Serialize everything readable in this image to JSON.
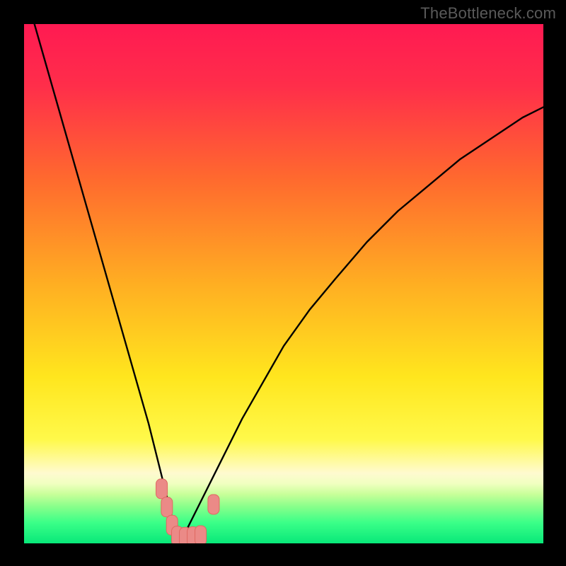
{
  "attribution": "TheBottleneck.com",
  "colors": {
    "frame": "#000000",
    "curve": "#000000",
    "marker_fill": "#eb8a87",
    "marker_stroke": "#e06862",
    "gradient_stops": [
      {
        "offset": 0.0,
        "color": "#ff1a52"
      },
      {
        "offset": 0.12,
        "color": "#ff2e4a"
      },
      {
        "offset": 0.3,
        "color": "#ff6a2e"
      },
      {
        "offset": 0.5,
        "color": "#ffae22"
      },
      {
        "offset": 0.68,
        "color": "#ffe61e"
      },
      {
        "offset": 0.8,
        "color": "#fff94a"
      },
      {
        "offset": 0.865,
        "color": "#fffad0"
      },
      {
        "offset": 0.885,
        "color": "#f0ffc0"
      },
      {
        "offset": 0.905,
        "color": "#c9ff9a"
      },
      {
        "offset": 0.93,
        "color": "#86ff8a"
      },
      {
        "offset": 0.96,
        "color": "#3bff88"
      },
      {
        "offset": 1.0,
        "color": "#08e879"
      }
    ]
  },
  "chart_data": {
    "type": "line",
    "title": "",
    "xlabel": "",
    "ylabel": "",
    "xlim": [
      0,
      100
    ],
    "ylim": [
      0,
      100
    ],
    "grid": false,
    "series": [
      {
        "name": "left-branch",
        "x": [
          2,
          4,
          6,
          8,
          10,
          12,
          14,
          16,
          18,
          20,
          22,
          24,
          26,
          27,
          28,
          29,
          30
        ],
        "y": [
          100,
          93,
          86,
          79,
          72,
          65,
          58,
          51,
          44,
          37,
          30,
          23,
          15,
          11,
          7,
          3,
          0
        ]
      },
      {
        "name": "right-branch",
        "x": [
          30,
          32,
          35,
          38,
          42,
          46,
          50,
          55,
          60,
          66,
          72,
          78,
          84,
          90,
          96,
          100
        ],
        "y": [
          0,
          4,
          10,
          16,
          24,
          31,
          38,
          45,
          51,
          58,
          64,
          69,
          74,
          78,
          82,
          84
        ]
      }
    ],
    "markers": [
      {
        "x": 26.5,
        "y": 10.5
      },
      {
        "x": 27.5,
        "y": 7.0
      },
      {
        "x": 28.5,
        "y": 3.5
      },
      {
        "x": 29.5,
        "y": 1.4
      },
      {
        "x": 31.0,
        "y": 1.2
      },
      {
        "x": 32.5,
        "y": 1.3
      },
      {
        "x": 34.0,
        "y": 1.5
      },
      {
        "x": 36.5,
        "y": 7.5
      }
    ],
    "baseline_y": 0
  }
}
